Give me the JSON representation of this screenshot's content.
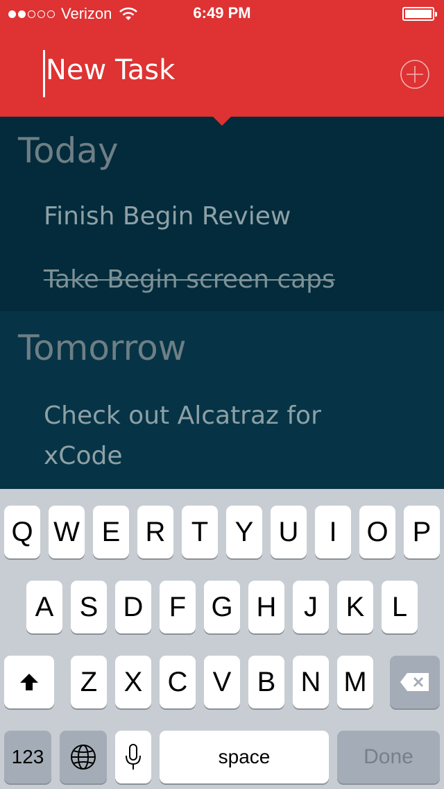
{
  "status_bar": {
    "carrier": "Verizon",
    "time": "6:49 PM"
  },
  "header": {
    "input_text": "New Task"
  },
  "sections": [
    {
      "title": "Today",
      "tasks": [
        {
          "text": "Finish Begin Review",
          "completed": false
        },
        {
          "text": "Take Begin screen caps",
          "completed": true
        }
      ]
    },
    {
      "title": "Tomorrow",
      "tasks": [
        {
          "text_line1": "Check out Alcatraz for",
          "text_line2": "xCode",
          "completed": false
        }
      ]
    }
  ],
  "keyboard": {
    "row1": [
      "Q",
      "W",
      "E",
      "R",
      "T",
      "Y",
      "U",
      "I",
      "O",
      "P"
    ],
    "row2": [
      "A",
      "S",
      "D",
      "F",
      "G",
      "H",
      "J",
      "K",
      "L"
    ],
    "row3": [
      "Z",
      "X",
      "C",
      "V",
      "B",
      "N",
      "M"
    ],
    "numbers_label": "123",
    "space_label": "space",
    "done_label": "Done"
  },
  "colors": {
    "header_red": "#de3233",
    "today_bg": "#032b3c",
    "tomorrow_bg": "#063446"
  }
}
